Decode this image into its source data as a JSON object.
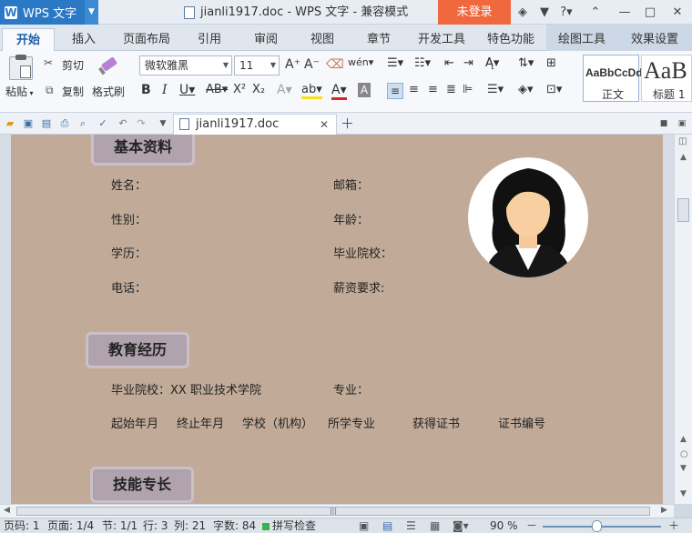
{
  "app": {
    "name": "WPS 文字",
    "window_title": "jianli1917.doc - WPS 文字 - 兼容模式",
    "login_label": "未登录"
  },
  "tabs": [
    "开始",
    "插入",
    "页面布局",
    "引用",
    "审阅",
    "视图",
    "章节",
    "开发工具",
    "特色功能",
    "绘图工具",
    "效果设置"
  ],
  "ribbon": {
    "paste_label": "粘贴",
    "cut_label": "剪切",
    "copy_label": "复制",
    "format_painter_label": "格式刷",
    "font_name": "微软雅黑",
    "font_size": "11",
    "styles": [
      {
        "preview": "AaBbCcDd",
        "name": "正文"
      },
      {
        "preview": "AaB",
        "name": "标题 1"
      }
    ]
  },
  "doc_tab": {
    "label": "jianli1917.doc"
  },
  "document": {
    "sections": [
      {
        "title": "基本资料"
      },
      {
        "title": "教育经历"
      },
      {
        "title": "技能专长"
      }
    ],
    "basic_fields": [
      "姓名：",
      "邮箱：",
      "性别：",
      "年龄：",
      "学历：",
      "毕业院校：",
      "电话：",
      "薪资要求:"
    ],
    "education": {
      "school": "毕业院校：XX 职业技术学院",
      "major": "专业：",
      "columns": [
        "起始年月",
        "终止年月",
        "学校（机构）",
        "所学专业",
        "获得证书",
        "证书编号"
      ]
    }
  },
  "status": {
    "page_no": "页码: 1",
    "pages": "页面: 1/4",
    "section": "节: 1/1",
    "line": "行: 3",
    "col": "列: 21",
    "words": "字数: 84",
    "spell_check": "拼写检查",
    "zoom": "90 %"
  },
  "colors": {
    "page_background": "#c1ab98",
    "section_header": "#b1a3ad",
    "login_button": "#f0683e",
    "app_menu": "#2b79c5"
  }
}
